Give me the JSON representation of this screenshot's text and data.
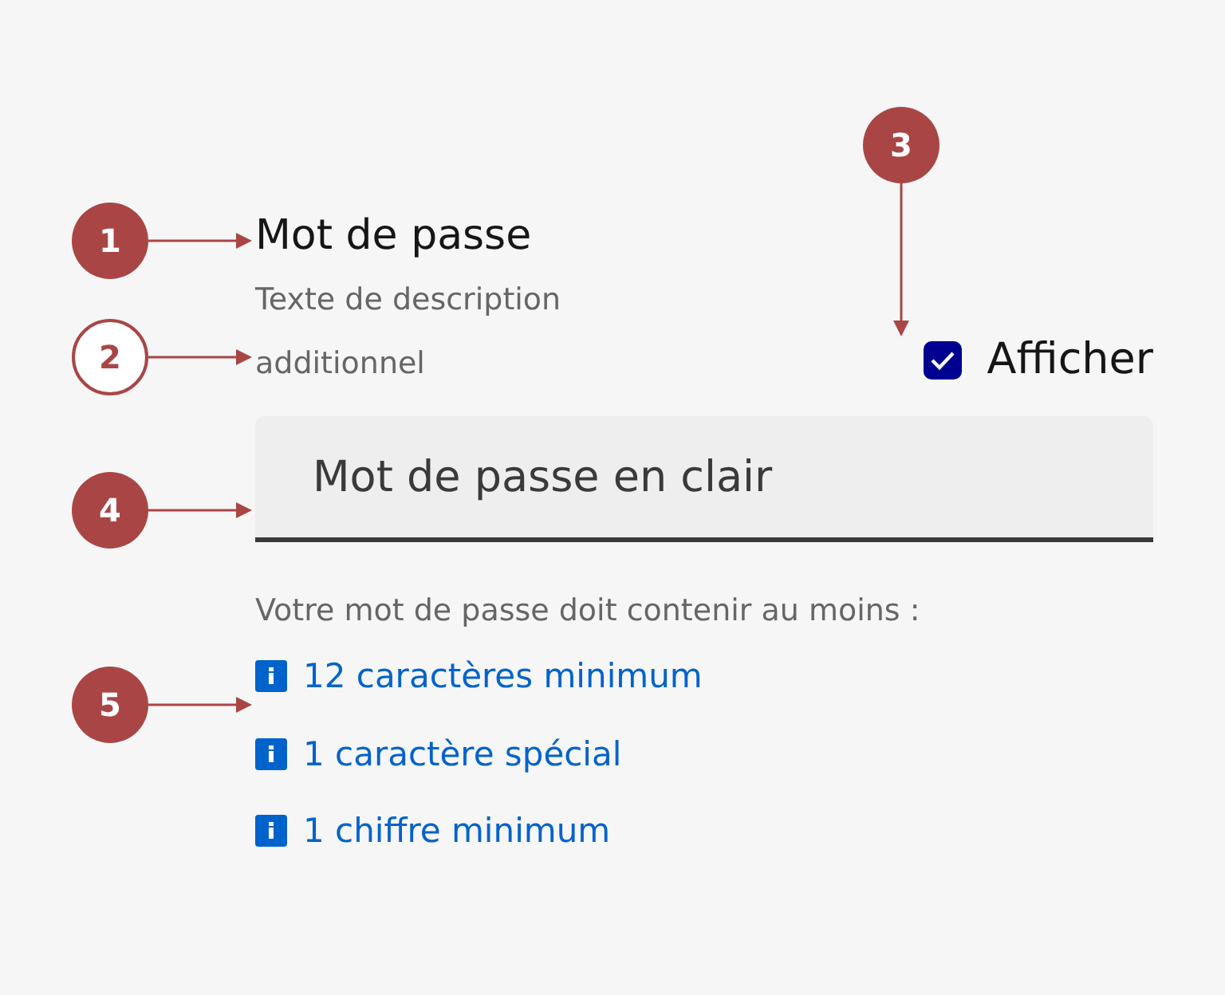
{
  "callouts": [
    {
      "number": "1",
      "outlined": false
    },
    {
      "number": "2",
      "outlined": true
    },
    {
      "number": "3",
      "outlined": false
    },
    {
      "number": "4",
      "outlined": false
    },
    {
      "number": "5",
      "outlined": false
    }
  ],
  "field": {
    "label": "Mot de passe",
    "description": "Texte de description additionnel",
    "value": "Mot de passe en clair"
  },
  "show_toggle": {
    "label": "Afficher",
    "checked": true
  },
  "requirements": {
    "intro": "Votre mot de passe doit contenir au moins :",
    "items": [
      "12 caractères minimum",
      "1 caractère spécial",
      "1 chiffre minimum"
    ]
  }
}
